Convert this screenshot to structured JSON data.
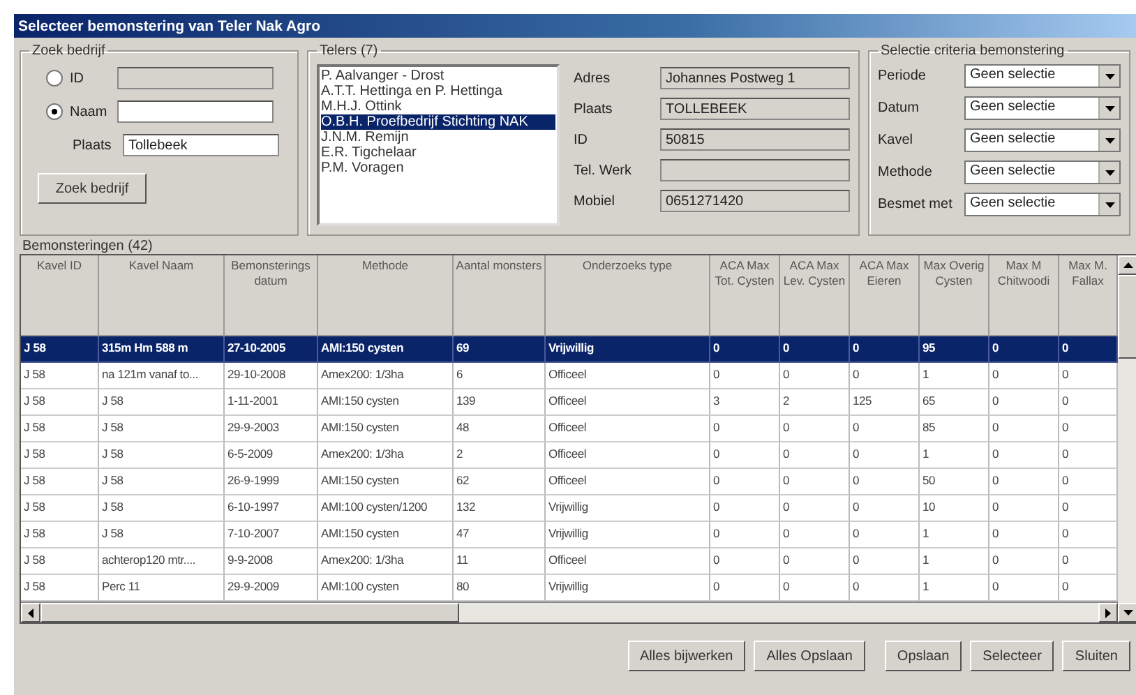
{
  "window": {
    "title": "Selecteer bemonstering van Teler Nak Agro"
  },
  "zoek_bedrijf": {
    "title": "Zoek bedrijf",
    "options": [
      {
        "label": "ID",
        "selected": false
      },
      {
        "label": "Naam",
        "selected": true
      }
    ],
    "plaats_label": "Plaats",
    "plaats_value": "Tollebeek",
    "button": "Zoek bedrijf"
  },
  "telers": {
    "title": "Telers (7)",
    "items": [
      {
        "label": "P. Aalvanger - Drost",
        "selected": false
      },
      {
        "label": "A.T.T. Hettinga en P. Hettinga",
        "selected": false
      },
      {
        "label": "M.H.J. Ottink",
        "selected": false
      },
      {
        "label": "O.B.H. Proefbedrijf Stichting NAK",
        "selected": true
      },
      {
        "label": "J.N.M. Remijn",
        "selected": false
      },
      {
        "label": "E.R. Tigchelaar",
        "selected": false
      },
      {
        "label": "P.M. Voragen",
        "selected": false
      }
    ]
  },
  "details": [
    {
      "label": "Adres",
      "value": "Johannes Postweg 1"
    },
    {
      "label": "Plaats",
      "value": "TOLLEBEEK"
    },
    {
      "label": "ID",
      "value": "50815"
    },
    {
      "label": "Tel. Werk"
    },
    {
      "label": "Mobiel",
      "value": "0651271420"
    }
  ],
  "criteria": {
    "title": "Selectie criteria bemonstering",
    "fields": [
      {
        "label": "Periode",
        "value": "Geen selectie"
      },
      {
        "label": "Datum",
        "value": "Geen selectie"
      },
      {
        "label": "Kavel",
        "value": "Geen selectie"
      },
      {
        "label": "Methode",
        "value": "Geen selectie"
      },
      {
        "label": "Besmet met",
        "value": "Geen selectie"
      }
    ]
  },
  "table": {
    "title": "Bemonsteringen (42)",
    "columns": [
      "Kavel ID",
      "Kavel Naam",
      "Bemonsterings datum",
      "Methode",
      "Aantal monsters",
      "Onderzoeks type",
      "ACA Max Tot. Cysten",
      "ACA Max Lev. Cysten",
      "ACA Max Eieren",
      "Max Overig Cysten",
      "Max M Chitwoodi",
      "Max M. Fallax"
    ],
    "rows": [
      {
        "selected": true,
        "cells": [
          "J 58",
          "315m Hm 588 m",
          "27-10-2005",
          "AMI:150 cysten",
          "69",
          "Vrijwillig",
          "0",
          "0",
          "0",
          "95",
          "0",
          "0"
        ]
      },
      {
        "selected": false,
        "cells": [
          "J 58",
          "na 121m vanaf to...",
          "29-10-2008",
          "Amex200: 1/3ha",
          "6",
          "Officeel",
          "0",
          "0",
          "0",
          "1",
          "0",
          "0"
        ]
      },
      {
        "selected": false,
        "cells": [
          "J 58",
          "J 58",
          "1-11-2001",
          "AMI:150 cysten",
          "139",
          "Officeel",
          "3",
          "2",
          "125",
          "65",
          "0",
          "0"
        ]
      },
      {
        "selected": false,
        "cells": [
          "J 58",
          "J 58",
          "29-9-2003",
          "AMI:150 cysten",
          "48",
          "Officeel",
          "0",
          "0",
          "0",
          "85",
          "0",
          "0"
        ]
      },
      {
        "selected": false,
        "cells": [
          "J 58",
          "J 58",
          "6-5-2009",
          "Amex200: 1/3ha",
          "2",
          "Officeel",
          "0",
          "0",
          "0",
          "1",
          "0",
          "0"
        ]
      },
      {
        "selected": false,
        "cells": [
          "J 58",
          "J 58",
          "26-9-1999",
          "AMI:150 cysten",
          "62",
          "Officeel",
          "0",
          "0",
          "0",
          "50",
          "0",
          "0"
        ]
      },
      {
        "selected": false,
        "cells": [
          "J 58",
          "J 58",
          "6-10-1997",
          "AMI:100 cysten/1200",
          "132",
          "Vrijwillig",
          "0",
          "0",
          "0",
          "10",
          "0",
          "0"
        ]
      },
      {
        "selected": false,
        "cells": [
          "J 58",
          "J 58",
          "7-10-2007",
          "AMI:150 cysten",
          "47",
          "Vrijwillig",
          "0",
          "0",
          "0",
          "1",
          "0",
          "0"
        ]
      },
      {
        "selected": false,
        "cells": [
          "J 58",
          "achterop120 mtr....",
          "9-9-2008",
          "Amex200: 1/3ha",
          "11",
          "Officeel",
          "0",
          "0",
          "0",
          "1",
          "0",
          "0"
        ]
      },
      {
        "selected": false,
        "cells": [
          "J 58",
          "Perc 11",
          "29-9-2009",
          "AMI:100 cysten",
          "80",
          "Vrijwillig",
          "0",
          "0",
          "0",
          "1",
          "0",
          "0"
        ]
      }
    ]
  },
  "buttons": [
    [
      "Alles bijwerken",
      "Alles Opslaan"
    ],
    [
      "Opslaan",
      "Selecteer",
      "Sluiten"
    ]
  ]
}
